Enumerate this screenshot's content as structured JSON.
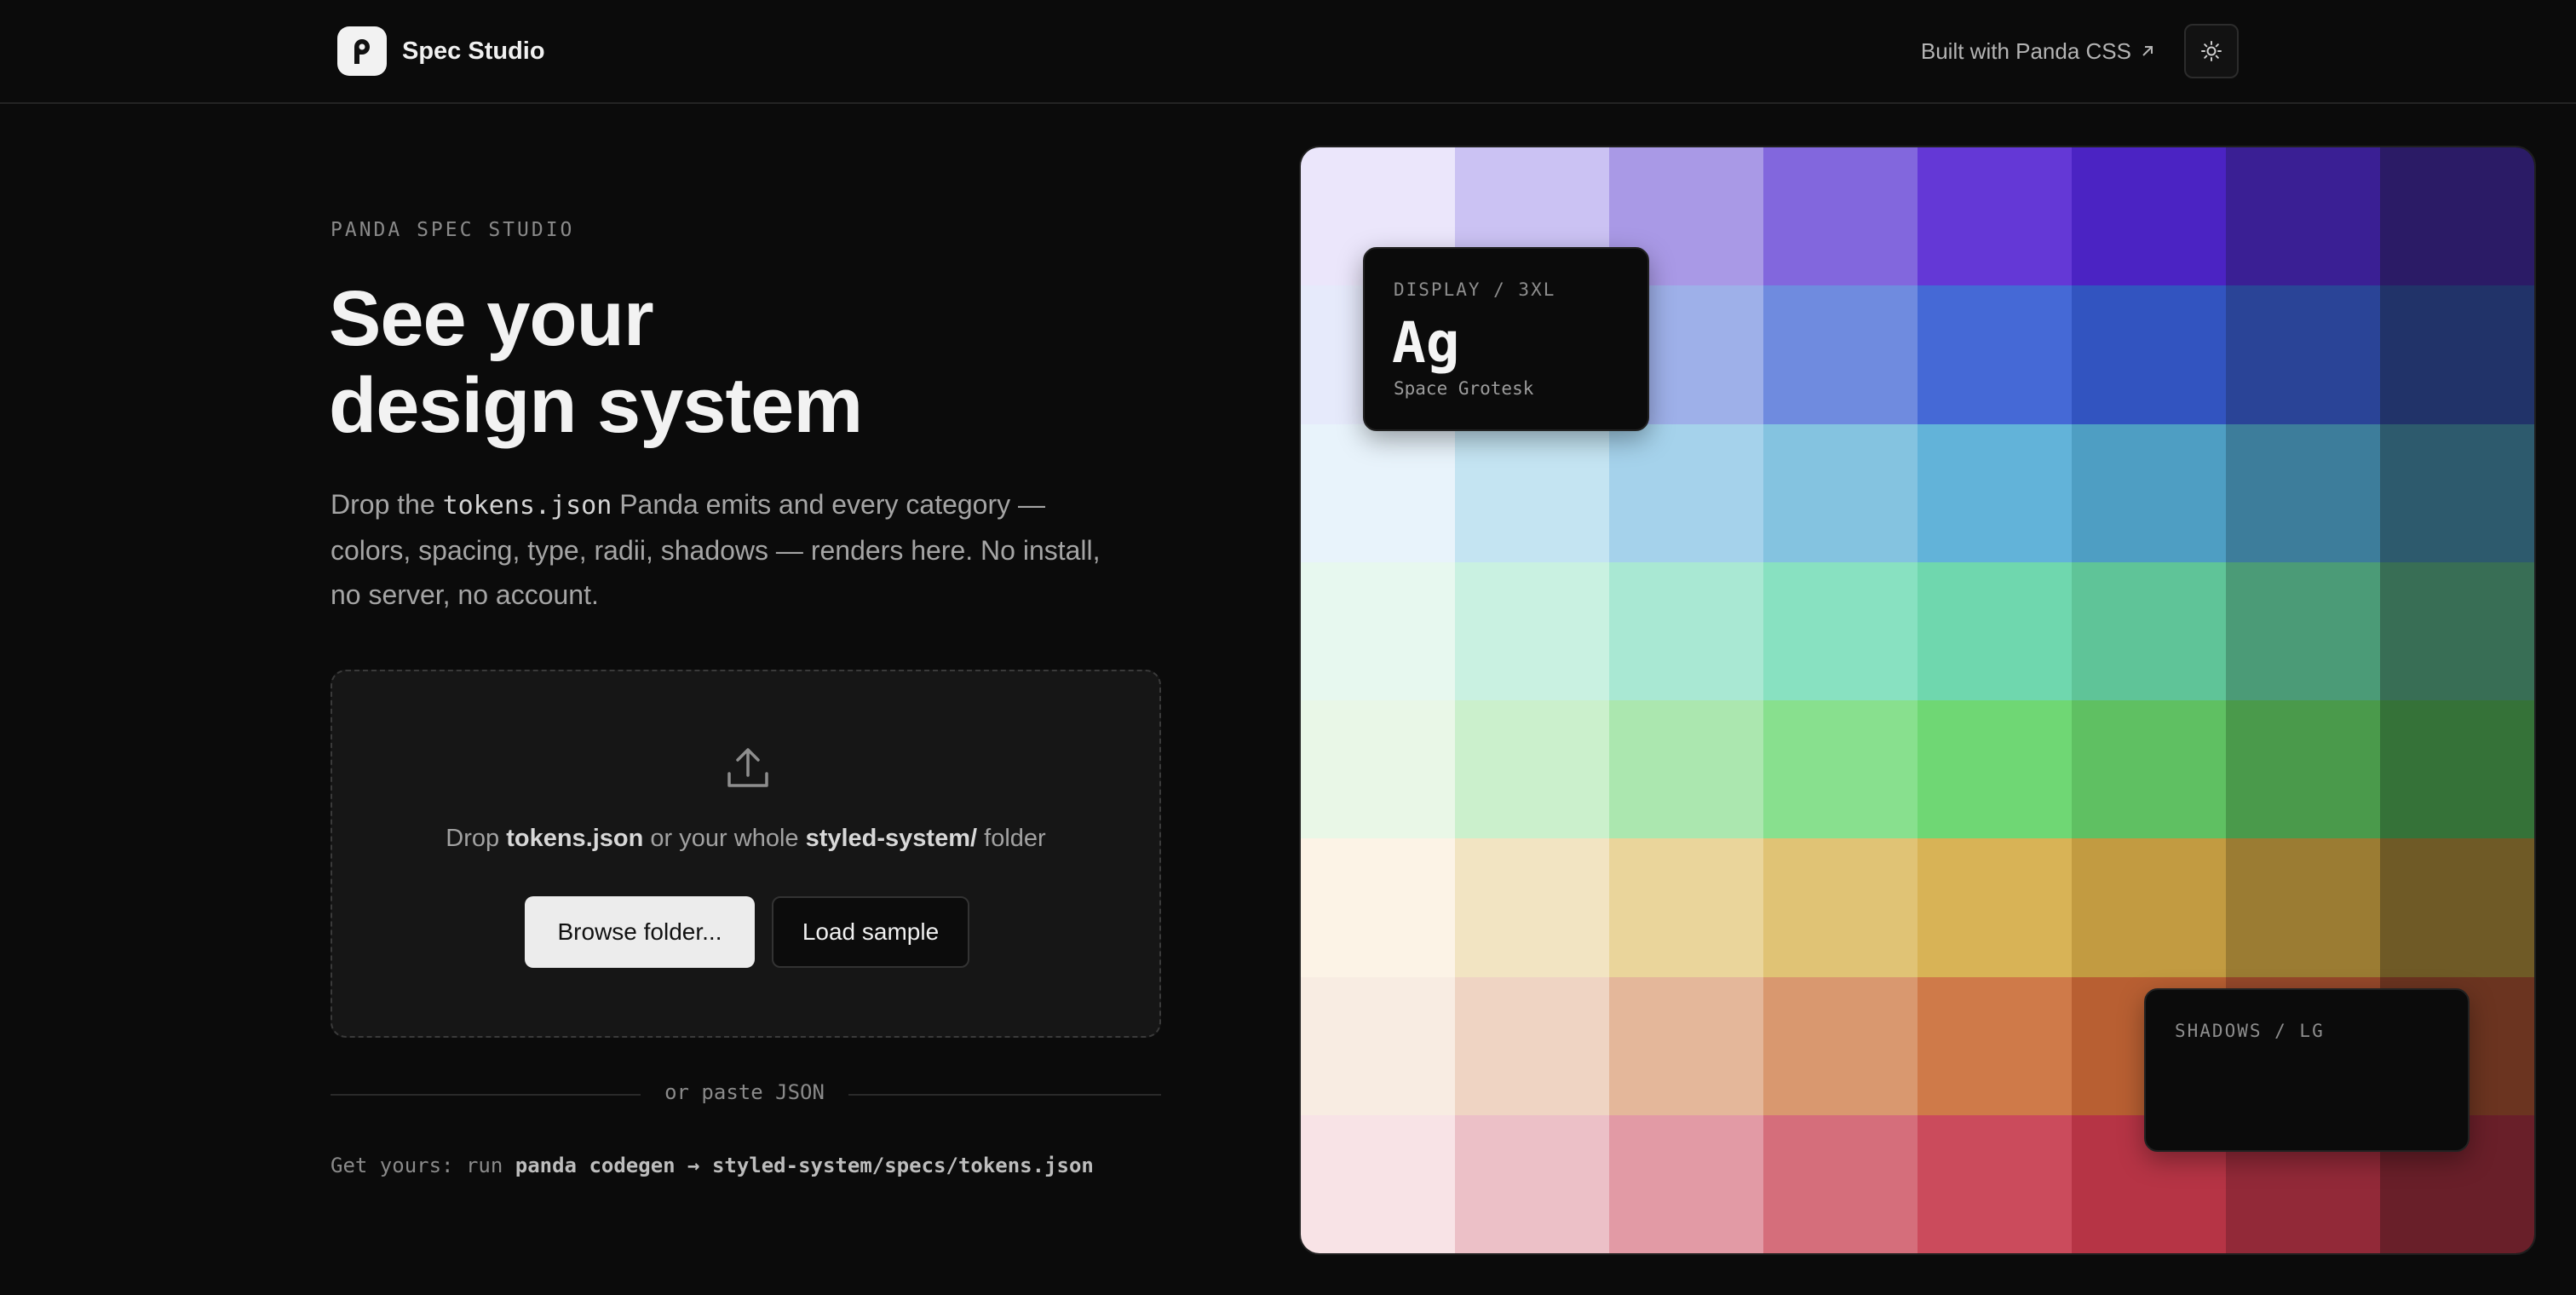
{
  "header": {
    "brand": "Spec Studio",
    "built_with": "Built with Panda CSS",
    "built_with_icon": "arrow-up-right-icon",
    "theme_icon": "sun-icon",
    "logo_icon": "panda-logo-icon"
  },
  "hero": {
    "eyebrow": "PANDA SPEC STUDIO",
    "title_line1": "See your",
    "title_line2": "design system",
    "desc_prefix": "Drop the ",
    "desc_code": "tokens.json",
    "desc_suffix": " Panda emits and every category — colors, spacing, type, radii, shadows — renders here. No install, no server, no account."
  },
  "dropzone": {
    "icon": "upload-icon",
    "text_prefix": "Drop ",
    "text_file": "tokens.json",
    "text_middle": " or your whole ",
    "text_folder": "styled-system/",
    "text_suffix": " folder",
    "browse_label": "Browse folder...",
    "sample_label": "Load sample"
  },
  "paste": {
    "divider_text": "or paste JSON"
  },
  "hint": {
    "prefix": "Get yours: run ",
    "command": "panda codegen → styled-system/specs/tokens.json"
  },
  "cards": {
    "type_label": "DISPLAY / 3XL",
    "type_sample": "Ag",
    "type_font": "Space Grotesk",
    "shadow_label": "SHADOWS / LG"
  },
  "palette": [
    [
      "#ebe6fb",
      "#cbc2f3",
      "#a999e6",
      "#8267dd",
      "#6438d6",
      "#4b23c3",
      "#3a1f94",
      "#2b1b66"
    ],
    [
      "#e6eafb",
      "#c2cdf3",
      "#9eb0e9",
      "#6f8bdf",
      "#4569d6",
      "#3254c0",
      "#2a4497",
      "#213369"
    ],
    [
      "#e8f3fb",
      "#c4e4f2",
      "#a5d2eb",
      "#84c3e0",
      "#62b3d9",
      "#4e9ec3",
      "#3d7d9b",
      "#2d5a6d"
    ],
    [
      "#e7f8ef",
      "#c9f1e1",
      "#a9e8d3",
      "#88e1c1",
      "#6fd7ae",
      "#5fc498",
      "#4b9b77",
      "#386e55"
    ],
    [
      "#e9f7e7",
      "#cbf0cc",
      "#abe7af",
      "#88e08e",
      "#6fd774",
      "#5fc062",
      "#4a9a4b",
      "#357238"
    ],
    [
      "#fcf3e6",
      "#f2e4c2",
      "#ead59b",
      "#e0c375",
      "#d8b356",
      "#c29b41",
      "#9b7c33",
      "#6f5a26"
    ],
    [
      "#f8ece2",
      "#efd4c3",
      "#e4b79a",
      "#d9986f",
      "#cf7a49",
      "#b85f32",
      "#96482a",
      "#6b3420"
    ],
    [
      "#f8e3e6",
      "#ecc0c7",
      "#e29aa5",
      "#d56e7b",
      "#cb4b5c",
      "#b63445",
      "#922938",
      "#691f29"
    ]
  ]
}
